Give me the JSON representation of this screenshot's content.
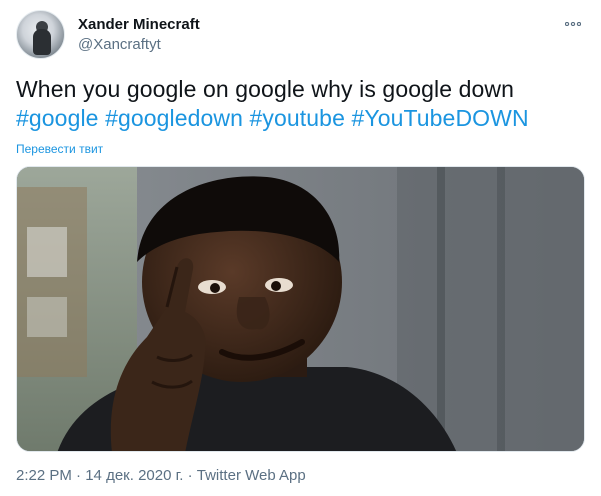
{
  "user": {
    "display_name": "Xander Minecraft",
    "handle": "@Xancraftyt"
  },
  "tweet": {
    "text": "When you google on google why is google down",
    "hashtags": [
      "#google",
      "#googledown",
      "#youtube",
      "#YouTubeDOWN"
    ],
    "translate_label": "Перевести твит"
  },
  "meta": {
    "time": "2:22 PM",
    "separator": "·",
    "date": "14 дек. 2020 г.",
    "source": "Twitter Web App"
  },
  "icons": {
    "more": "more-dots-icon",
    "avatar": "avatar"
  },
  "colors": {
    "link": "#1b95e0",
    "secondary_text": "#5b7083",
    "primary_text": "#0f1419"
  }
}
